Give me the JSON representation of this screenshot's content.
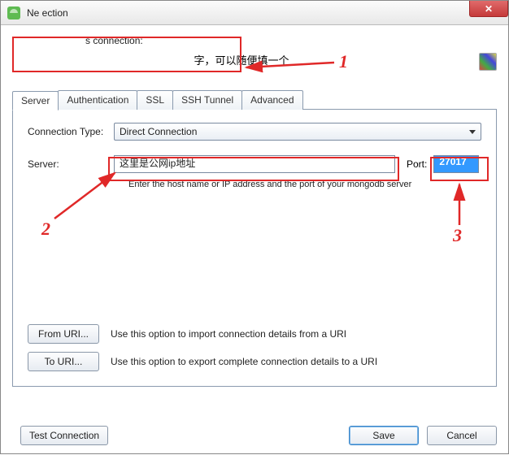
{
  "window": {
    "title": "Ne        ection"
  },
  "name": {
    "label": "s connection:",
    "value": "字，可以随便填一个"
  },
  "tabs": {
    "server": "Server",
    "authentication": "Authentication",
    "ssl": "SSL",
    "ssh": "SSH Tunnel",
    "advanced": "Advanced"
  },
  "panel": {
    "conn_type_label": "Connection Type:",
    "conn_type_value": "Direct Connection",
    "server_label": "Server:",
    "server_value": "这里是公网ip地址",
    "port_label": "Port:",
    "port_value": "27017",
    "hint": "Enter the host name or IP address and the port of your mongodb server"
  },
  "uri": {
    "from_label": "From URI...",
    "from_text": "Use this option to import connection details from a URI",
    "to_label": "To URI...",
    "to_text": "Use this option to export complete connection details to a URI"
  },
  "footer": {
    "test": "Test Connection",
    "save": "Save",
    "cancel": "Cancel"
  },
  "annotations": {
    "one": "1",
    "two": "2",
    "three": "3"
  }
}
